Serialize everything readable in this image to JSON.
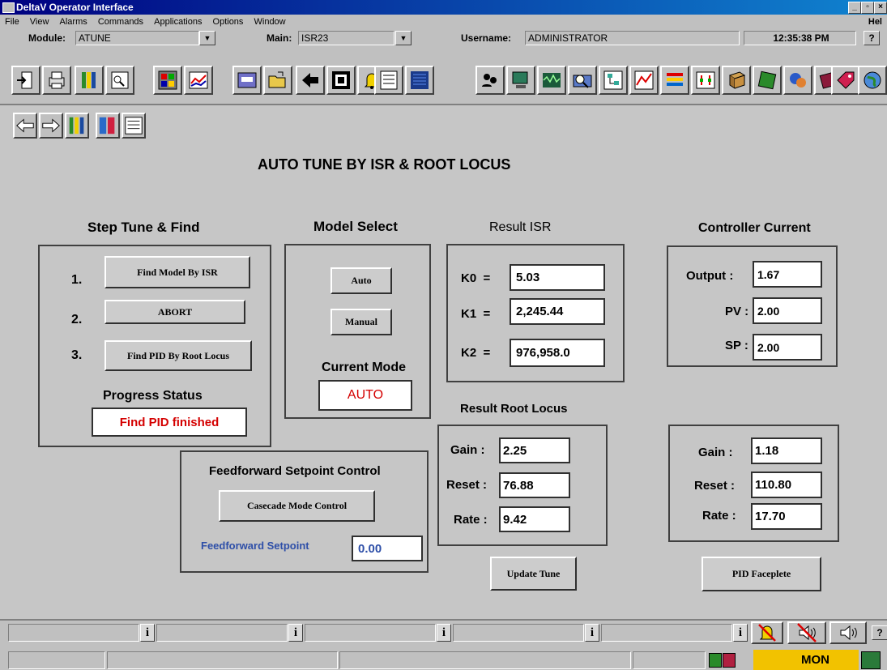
{
  "window": {
    "title": "DeltaV Operator Interface",
    "help": "Hel"
  },
  "menu": [
    "File",
    "View",
    "Alarms",
    "Commands",
    "Applications",
    "Options",
    "Window"
  ],
  "header": {
    "module_label": "Module:",
    "module_value": "ATUNE",
    "main_label": "Main:",
    "main_value": "ISR23",
    "username_label": "Username:",
    "username_value": "ADMINISTRATOR",
    "time": "12:35:38 PM",
    "help_button": "?"
  },
  "page": {
    "title": "AUTO TUNE BY ISR & ROOT LOCUS"
  },
  "step_tune": {
    "heading": "Step Tune & Find",
    "steps": [
      {
        "num": "1.",
        "label": "Find Model By ISR"
      },
      {
        "num": "2.",
        "label": "ABORT"
      },
      {
        "num": "3.",
        "label": "Find PID By Root Locus"
      }
    ],
    "progress_label": "Progress Status",
    "progress_value": "Find PID finished"
  },
  "model_select": {
    "heading": "Model Select",
    "auto_button": "Auto",
    "manual_button": "Manual",
    "current_mode_label": "Current Mode",
    "current_mode_value": "AUTO"
  },
  "result_isr": {
    "heading": "Result ISR",
    "rows": [
      {
        "label": "K0  =",
        "value": "5.03"
      },
      {
        "label": "K1  =",
        "value": "2,245.44"
      },
      {
        "label": "K2  =",
        "value": "976,958.0"
      }
    ]
  },
  "controller_current": {
    "heading": "Controller Current",
    "rows": [
      {
        "label": "Output :",
        "value": "1.67"
      },
      {
        "label": "PV :",
        "value": "2.00"
      },
      {
        "label": "SP :",
        "value": "2.00"
      }
    ]
  },
  "result_root_locus": {
    "heading": "Result Root Locus",
    "rows": [
      {
        "label": "Gain :",
        "value": "2.25"
      },
      {
        "label": "Reset :",
        "value": "76.88"
      },
      {
        "label": "Rate :",
        "value": "9.42"
      }
    ],
    "button": "Update Tune"
  },
  "controller_tuning": {
    "rows": [
      {
        "label": "Gain :",
        "value": "1.18"
      },
      {
        "label": "Reset :",
        "value": "110.80"
      },
      {
        "label": "Rate :",
        "value": "17.70"
      }
    ],
    "button": "PID Faceplete"
  },
  "feedforward": {
    "heading": "Feedforward Setpoint Control",
    "button": "Casecade Mode Control",
    "setpoint_label": "Feedforward Setpoint",
    "setpoint_value": "0.00"
  },
  "status_bar": {
    "info_glyph": "i",
    "mode": "MON",
    "help": "?"
  },
  "colors": {
    "background": "#c6c6c6",
    "status_red": "#d40000",
    "feedforward_blue": "#2e4fa8",
    "mon_yellow": "#f2c200",
    "title_blue": "#000080"
  }
}
